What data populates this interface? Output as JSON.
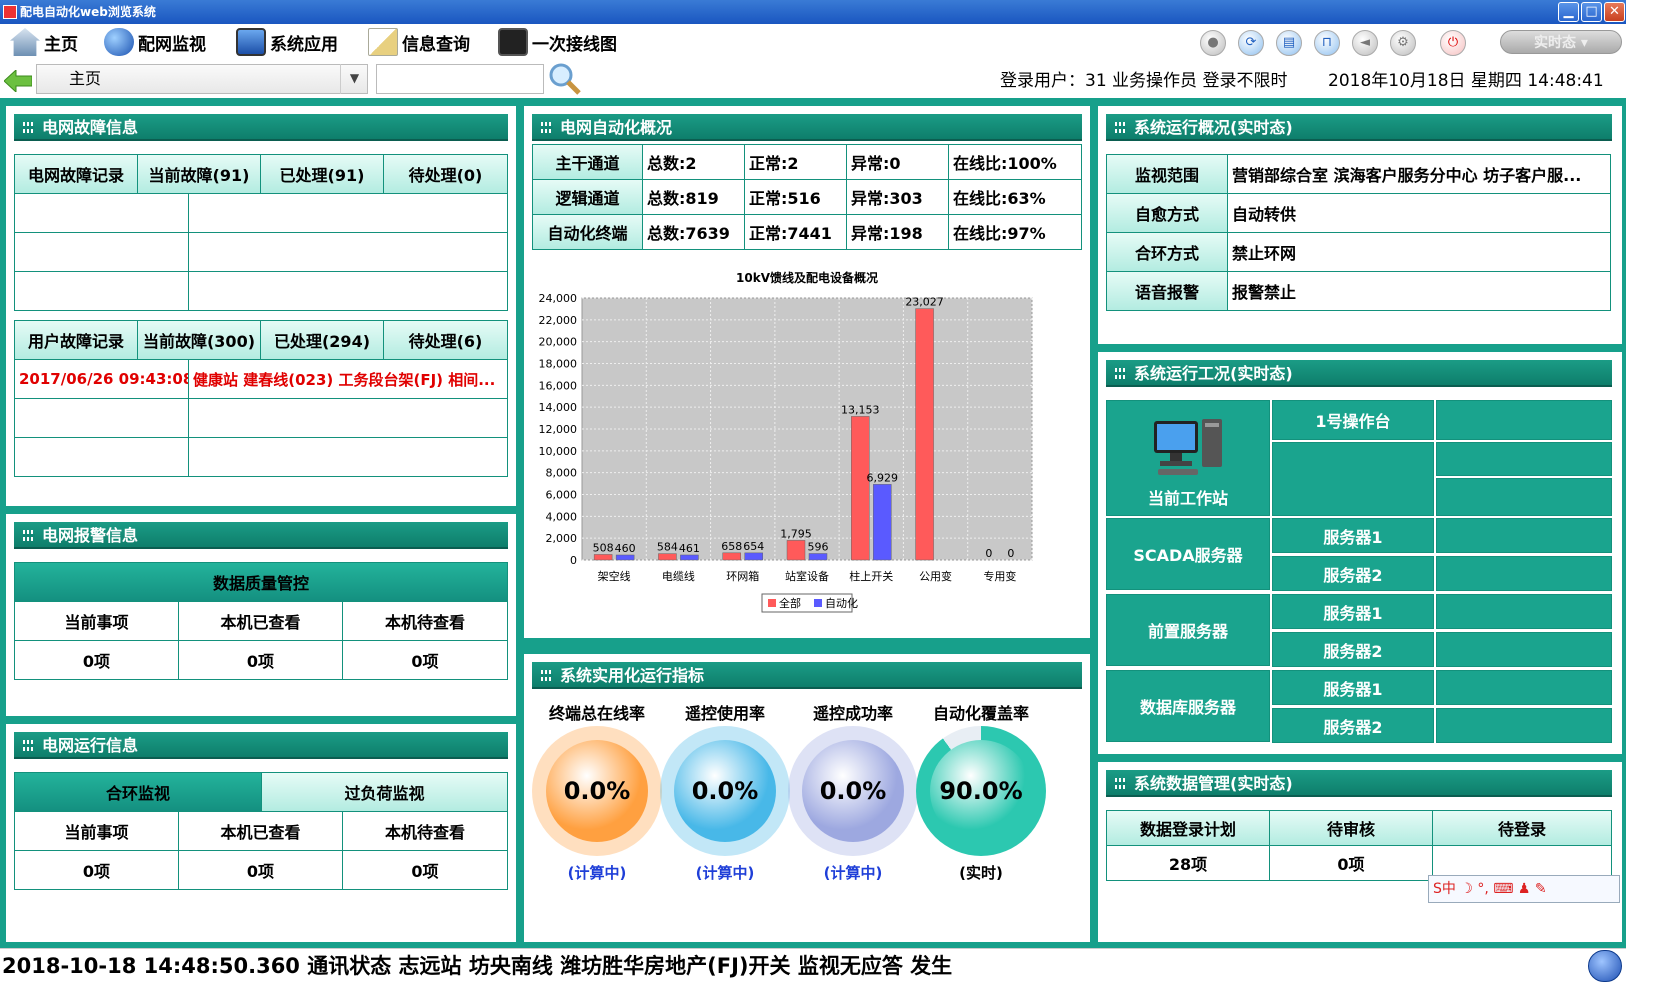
{
  "window": {
    "title": "配电自动化web浏览系统",
    "controls": [
      "minimize-icon",
      "maximize-icon",
      "close-icon"
    ]
  },
  "menu": [
    {
      "label": "主页",
      "icon": "home-icon"
    },
    {
      "label": "配网监视",
      "icon": "globe-icon"
    },
    {
      "label": "系统应用",
      "icon": "monitor-icon"
    },
    {
      "label": "信息查询",
      "icon": "mail-icon"
    },
    {
      "label": "一次接线图",
      "icon": "diagram-icon"
    }
  ],
  "toolbar": {
    "icons": [
      "location-icon",
      "refresh-icon",
      "print-icon",
      "lock-icon",
      "sound-icon",
      "settings-icon",
      "power-icon"
    ],
    "state_label": "实时态"
  },
  "nav": {
    "current_page": "主页",
    "search_value": "",
    "user_info": "登录用户：31 业务操作员  登录不限时",
    "datetime": "2018年10月18日 星期四 14:48:41"
  },
  "fault": {
    "title": "电网故障信息",
    "grid_headers": [
      "电网故障记录",
      "当前故障(91)",
      "已处理(91)",
      "待处理(0)"
    ],
    "user_headers": [
      "用户故障记录",
      "当前故障(300)",
      "已处理(294)",
      "待处理(6)"
    ],
    "user_rows": [
      {
        "time": "2017/06/26 09:43:08",
        "desc": "健康站 建春线(023) 工务段台架(FJ) 相间..."
      }
    ]
  },
  "alarm": {
    "title": "电网报警信息",
    "sub_title": "数据质量管控",
    "headers": [
      "当前事项",
      "本机已查看",
      "本机待查看"
    ],
    "values": [
      "0项",
      "0项",
      "0项"
    ]
  },
  "operation": {
    "title": "电网运行信息",
    "tabs": [
      "合环监视",
      "过负荷监视"
    ],
    "headers": [
      "当前事项",
      "本机已查看",
      "本机待查看"
    ],
    "values": [
      "0项",
      "0项",
      "0项"
    ]
  },
  "automation": {
    "title": "电网自动化概况",
    "rows": [
      {
        "name": "主干通道",
        "total": "总数:2",
        "normal": "正常:2",
        "abnormal": "异常:0",
        "online": "在线比:100%"
      },
      {
        "name": "逻辑通道",
        "total": "总数:819",
        "normal": "正常:516",
        "abnormal": "异常:303",
        "online": "在线比:63%"
      },
      {
        "name": "自动化终端",
        "total": "总数:7639",
        "normal": "正常:7441",
        "abnormal": "异常:198",
        "online": "在线比:97%"
      }
    ]
  },
  "chart_data": {
    "type": "bar",
    "title": "10kV馈线及配电设备概况",
    "categories": [
      "架空线",
      "电缆线",
      "环网箱",
      "站室设备",
      "柱上开关",
      "公用变",
      "专用变"
    ],
    "series": [
      {
        "name": "全部",
        "color": "#ff5a5a",
        "values": [
          508,
          584,
          658,
          1795,
          13153,
          23027,
          0
        ]
      },
      {
        "name": "自动化",
        "color": "#5a5aff",
        "values": [
          460,
          461,
          654,
          596,
          6929,
          0,
          0
        ]
      }
    ],
    "ylim": [
      0,
      24000
    ],
    "yticks": [
      "0",
      "2,000",
      "4,000",
      "6,000",
      "8,000",
      "10,000",
      "12,000",
      "14,000",
      "16,000",
      "18,000",
      "20,000",
      "22,000",
      "24,000"
    ],
    "data_labels": [
      [
        "508",
        "584",
        "658",
        "1,795",
        "13,153",
        "23,027",
        "0"
      ],
      [
        "460",
        "461",
        "654",
        "596",
        "6,929",
        "",
        "0"
      ]
    ],
    "grid": true,
    "legend": "bottom"
  },
  "utilization": {
    "title": "系统实用化运行指标",
    "gauges": [
      {
        "label": "终端总在线率",
        "value": "0.0%",
        "sub": "(计算中)",
        "color": "#ffa040"
      },
      {
        "label": "遥控使用率",
        "value": "0.0%",
        "sub": "(计算中)",
        "color": "#48b8e8"
      },
      {
        "label": "遥控成功率",
        "value": "0.0%",
        "sub": "(计算中)",
        "color": "#9da8e0"
      },
      {
        "label": "自动化覆盖率",
        "value": "90.0%",
        "sub": "(实时)",
        "color": "#2cc8b0",
        "fraction": 0.9
      }
    ]
  },
  "sysover": {
    "title": "系统运行概况(实时态)",
    "rows": [
      {
        "key": "监视范围",
        "value": "营销部综合室 滨海客户服务分中心 坊子客户服..."
      },
      {
        "key": "自愈方式",
        "value": "自动转供"
      },
      {
        "key": "合环方式",
        "value": "禁止环网"
      },
      {
        "key": "语音报警",
        "value": "报警禁止"
      }
    ]
  },
  "syswork": {
    "title": "系统运行工况(实时态)",
    "workstation": "当前工作站",
    "console": "1号操作台",
    "groups": [
      {
        "name": "SCADA服务器",
        "servers": [
          "服务器1",
          "服务器2"
        ]
      },
      {
        "name": "前置服务器",
        "servers": [
          "服务器1",
          "服务器2"
        ]
      },
      {
        "name": "数据库服务器",
        "servers": [
          "服务器1",
          "服务器2"
        ]
      }
    ]
  },
  "sysdata": {
    "title": "系统数据管理(实时态)",
    "headers": [
      "数据登录计划",
      "待审核",
      "待登录"
    ],
    "values": [
      "28项",
      "0项",
      ""
    ]
  },
  "status_bar": {
    "message": "2018-10-18 14:48:50.360 通讯状态 志远站 坊央南线 潍坊胜华房地产(FJ)开关   监视无应答   发生"
  },
  "ime": {
    "label": "S中 ☽ °, ⌨ ♟ ✎"
  }
}
